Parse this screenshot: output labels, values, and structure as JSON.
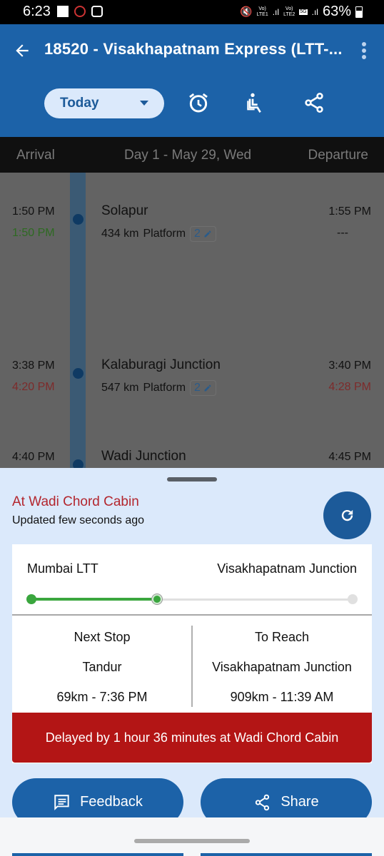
{
  "status_bar": {
    "time": "6:23",
    "battery": "63%",
    "sim1": "LTE1",
    "sim2": "LTE2",
    "network": "5G"
  },
  "app_bar": {
    "title": "18520 - Visakhapatnam Express (LTT-...",
    "date_selector": "Today",
    "icons": [
      "back-arrow-icon",
      "more-vert-icon",
      "alarm-icon",
      "seat-icon",
      "share-icon"
    ]
  },
  "day_header": {
    "arrival": "Arrival",
    "day": "Day 1 - May 29, Wed",
    "departure": "Departure"
  },
  "stops": [
    {
      "name": "Solapur",
      "sched_arr": "1:50 PM",
      "actual_arr": "1:50 PM",
      "sched_dep": "1:55 PM",
      "actual_dep": "---",
      "distance": "434 km",
      "platform_label": "Platform",
      "platform": "2",
      "status": "on-time"
    },
    {
      "name": "Kalaburagi Junction",
      "sched_arr": "3:38 PM",
      "actual_arr": "4:20 PM",
      "sched_dep": "3:40 PM",
      "actual_dep": "4:28 PM",
      "distance": "547 km",
      "platform_label": "Platform",
      "platform": "2",
      "status": "late"
    },
    {
      "name": "Wadi Junction",
      "sched_arr": "4:40 PM",
      "sched_dep": "4:45 PM"
    }
  ],
  "live_status": {
    "location": "At Wadi Chord Cabin",
    "updated": "Updated few seconds ago",
    "origin": "Mumbai LTT",
    "destination": "Visakhapatnam Junction",
    "progress_fraction": 0.39,
    "next_stop_label": "Next Stop",
    "next_stop": "Tandur",
    "next_stop_eta": "69km - 7:36 PM",
    "to_reach_label": "To Reach",
    "to_reach": "Visakhapatnam Junction",
    "to_reach_eta": "909km - 11:39 AM",
    "delay_message": "Delayed by 1 hour 36 minutes at Wadi Chord Cabin"
  },
  "actions": {
    "feedback": "Feedback",
    "share": "Share"
  },
  "colors": {
    "primary": "#1c62a8",
    "sheet_bg": "#dbe9fb",
    "delay_red": "#b31515",
    "progress_green": "#3aa63e",
    "location_red": "#b3262e"
  }
}
